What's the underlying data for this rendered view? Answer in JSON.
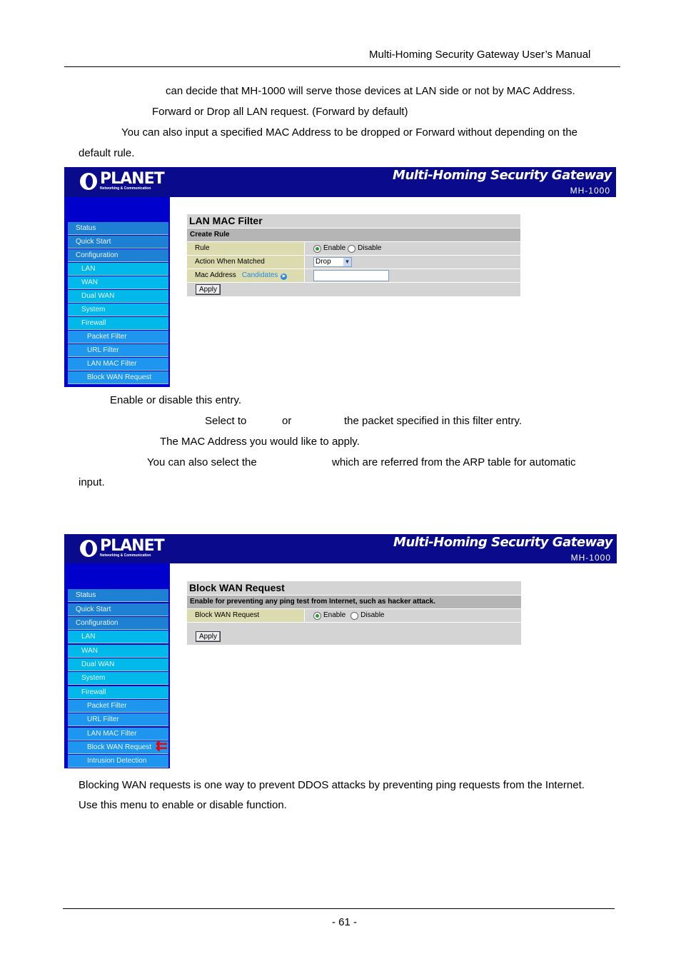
{
  "header": {
    "title": "Multi-Homing  Security  Gateway  User’s  Manual"
  },
  "intro": [
    "can decide that MH-1000 will serve those devices at LAN side or not by MAC Address.",
    "Forward or Drop all LAN request. (Forward by default)",
    "You can also input a specified MAC Address to be dropped or Forward without depending on the",
    "default rule."
  ],
  "brand": {
    "logo": "PLANET",
    "logo_sub": "Networking & Communication",
    "product": "Multi-Homing Security Gateway",
    "model": "MH-1000"
  },
  "menu": [
    "Status",
    "Quick Start",
    "Configuration",
    "LAN",
    "WAN",
    "Dual WAN",
    "System",
    "Firewall",
    "Packet Filter",
    "URL Filter",
    "LAN MAC Filter",
    "Block WAN Request",
    "Intrusion Detection"
  ],
  "shot1": {
    "title": "LAN MAC Filter",
    "section": "Create Rule",
    "rows": {
      "rule": "Rule",
      "enable": "Enable",
      "disable": "Disable",
      "action": "Action When Matched",
      "action_value": "Drop",
      "mac": "Mac Address",
      "candidates": "Candidates",
      "mac_value": ""
    },
    "apply": "Apply"
  },
  "desc1": [
    "Enable or disable this entry.",
    "Select to",
    "or",
    "the packet specified in this filter entry.",
    "The MAC Address you would like to apply.",
    "You can also select the",
    "which are referred from the ARP table for automatic",
    "input."
  ],
  "shot2": {
    "title": "Block WAN Request",
    "section": "Enable for preventing any ping test from Internet, such as hacker attack.",
    "label": "Block WAN Request",
    "enable": "Enable",
    "disable": "Disable",
    "apply": "Apply"
  },
  "desc2": [
    "Blocking WAN requests is one way to prevent DDOS attacks by preventing ping requests from the Internet.",
    "Use this menu to enable or disable function."
  ],
  "footer": {
    "page": "- 61 -"
  },
  "colors": {
    "header": "#0a0a8c",
    "sidebar": "#0000cc",
    "arrow": "#e00000"
  }
}
